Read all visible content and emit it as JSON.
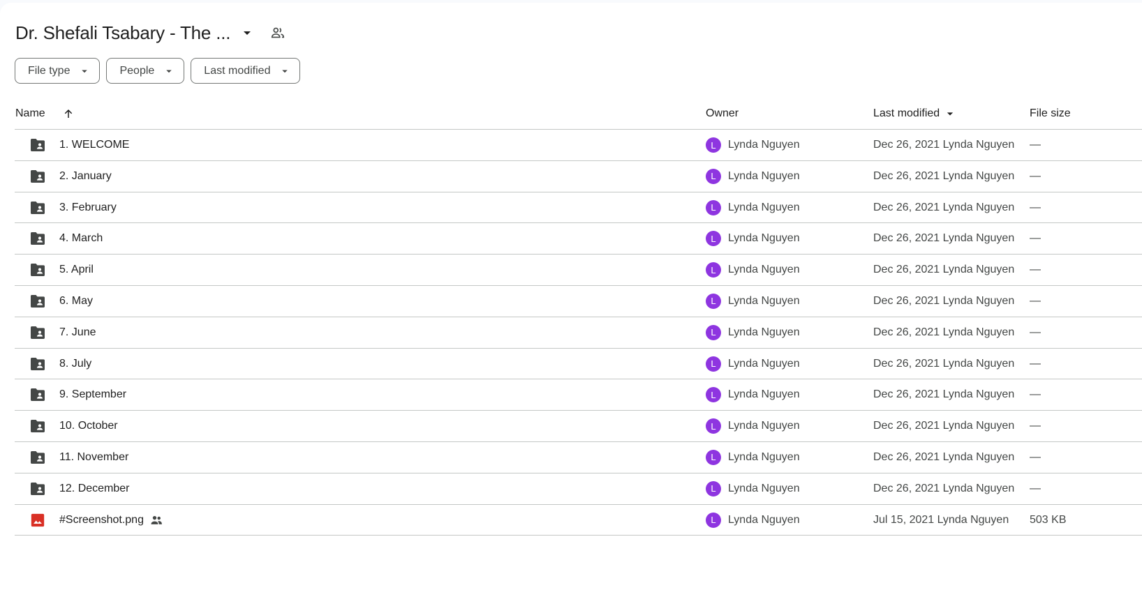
{
  "title": {
    "text": "Dr. Shefali Tsabary - The ...",
    "caret_icon": "arrow-drop-down-icon",
    "shared_icon": "shared-people-icon"
  },
  "filters": [
    {
      "label": "File type"
    },
    {
      "label": "People"
    },
    {
      "label": "Last modified"
    }
  ],
  "columns": {
    "name": "Name",
    "owner": "Owner",
    "last_modified": "Last modified",
    "file_size": "File size"
  },
  "files": [
    {
      "name": "1. WELCOME",
      "type": "shared-folder",
      "owner": "Lynda Nguyen",
      "owner_initial": "L",
      "modified": "Dec 26, 2021 Lynda Nguyen",
      "size": "—"
    },
    {
      "name": "2. January",
      "type": "shared-folder",
      "owner": "Lynda Nguyen",
      "owner_initial": "L",
      "modified": "Dec 26, 2021 Lynda Nguyen",
      "size": "—"
    },
    {
      "name": "3. February",
      "type": "shared-folder",
      "owner": "Lynda Nguyen",
      "owner_initial": "L",
      "modified": "Dec 26, 2021 Lynda Nguyen",
      "size": "—"
    },
    {
      "name": "4. March",
      "type": "shared-folder",
      "owner": "Lynda Nguyen",
      "owner_initial": "L",
      "modified": "Dec 26, 2021 Lynda Nguyen",
      "size": "—"
    },
    {
      "name": "5. April",
      "type": "shared-folder",
      "owner": "Lynda Nguyen",
      "owner_initial": "L",
      "modified": "Dec 26, 2021 Lynda Nguyen",
      "size": "—"
    },
    {
      "name": "6. May",
      "type": "shared-folder",
      "owner": "Lynda Nguyen",
      "owner_initial": "L",
      "modified": "Dec 26, 2021 Lynda Nguyen",
      "size": "—"
    },
    {
      "name": "7. June",
      "type": "shared-folder",
      "owner": "Lynda Nguyen",
      "owner_initial": "L",
      "modified": "Dec 26, 2021 Lynda Nguyen",
      "size": "—"
    },
    {
      "name": "8. July",
      "type": "shared-folder",
      "owner": "Lynda Nguyen",
      "owner_initial": "L",
      "modified": "Dec 26, 2021 Lynda Nguyen",
      "size": "—"
    },
    {
      "name": "9. September",
      "type": "shared-folder",
      "owner": "Lynda Nguyen",
      "owner_initial": "L",
      "modified": "Dec 26, 2021 Lynda Nguyen",
      "size": "—"
    },
    {
      "name": "10. October",
      "type": "shared-folder",
      "owner": "Lynda Nguyen",
      "owner_initial": "L",
      "modified": "Dec 26, 2021 Lynda Nguyen",
      "size": "—"
    },
    {
      "name": "11. November",
      "type": "shared-folder",
      "owner": "Lynda Nguyen",
      "owner_initial": "L",
      "modified": "Dec 26, 2021 Lynda Nguyen",
      "size": "—"
    },
    {
      "name": "12. December",
      "type": "shared-folder",
      "owner": "Lynda Nguyen",
      "owner_initial": "L",
      "modified": "Dec 26, 2021 Lynda Nguyen",
      "size": "—"
    },
    {
      "name": "#Screenshot.png",
      "type": "image",
      "shared": true,
      "owner": "Lynda Nguyen",
      "owner_initial": "L",
      "modified": "Jul 15, 2021 Lynda Nguyen",
      "size": "503 KB"
    }
  ],
  "colors": {
    "avatar": "#8e35e0",
    "folder_icon": "#444746",
    "image_icon": "#d93025"
  }
}
